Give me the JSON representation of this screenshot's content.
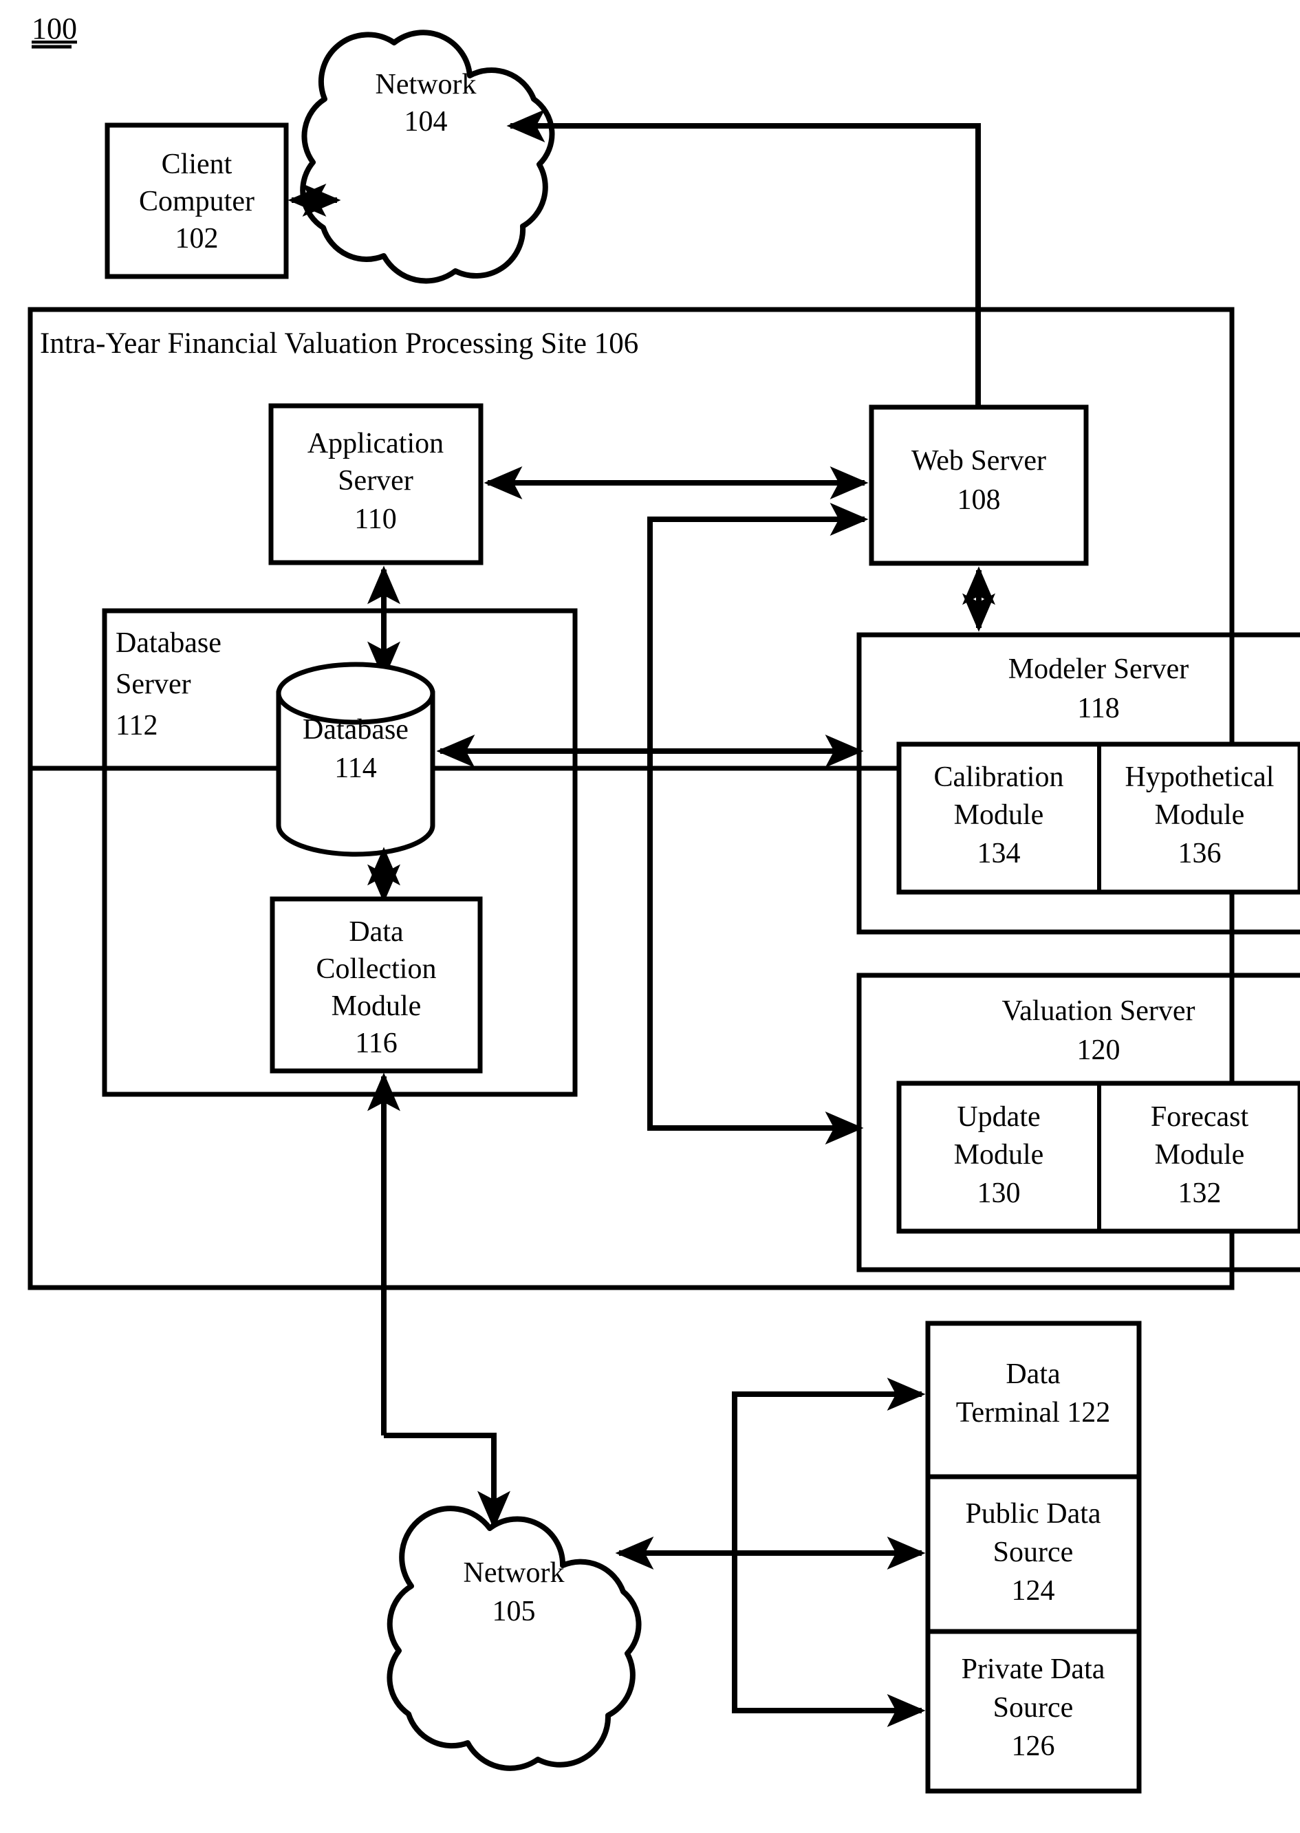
{
  "figure": {
    "number": "100",
    "site_label": "Intra-Year Financial Valuation Processing Site 106"
  },
  "nodes": {
    "client_computer": {
      "line1": "Client",
      "line2": "Computer",
      "line3": "102"
    },
    "network_top": {
      "line1": "Network",
      "line2": "104"
    },
    "application_server": {
      "line1": "Application",
      "line2": "Server",
      "line3": "110"
    },
    "web_server": {
      "line1": "Web Server",
      "line2": "108"
    },
    "database_server": {
      "line1": "Database",
      "line2": "Server",
      "line3": "112"
    },
    "database": {
      "line1": "Database",
      "line2": "114"
    },
    "data_collection_module": {
      "line1": "Data",
      "line2": "Collection",
      "line3": "Module",
      "line4": "116"
    },
    "modeler_server": {
      "line1": "Modeler Server",
      "line2": "118"
    },
    "calibration_module": {
      "line1": "Calibration",
      "line2": "Module",
      "line3": "134"
    },
    "hypothetical_module": {
      "line1": "Hypothetical",
      "line2": "Module",
      "line3": "136"
    },
    "valuation_server": {
      "line1": "Valuation Server",
      "line2": "120"
    },
    "update_module": {
      "line1": "Update",
      "line2": "Module",
      "line3": "130"
    },
    "forecast_module": {
      "line1": "Forecast",
      "line2": "Module",
      "line3": "132"
    },
    "network_bottom": {
      "line1": "Network",
      "line2": "105"
    },
    "data_terminal": {
      "line1": "Data",
      "line2": "Terminal 122"
    },
    "public_data_source": {
      "line1": "Public Data",
      "line2": "Source",
      "line3": "124"
    },
    "private_data_source": {
      "line1": "Private Data",
      "line2": "Source",
      "line3": "126"
    }
  },
  "colors": {
    "stroke": "#000000",
    "fill": "#ffffff"
  }
}
